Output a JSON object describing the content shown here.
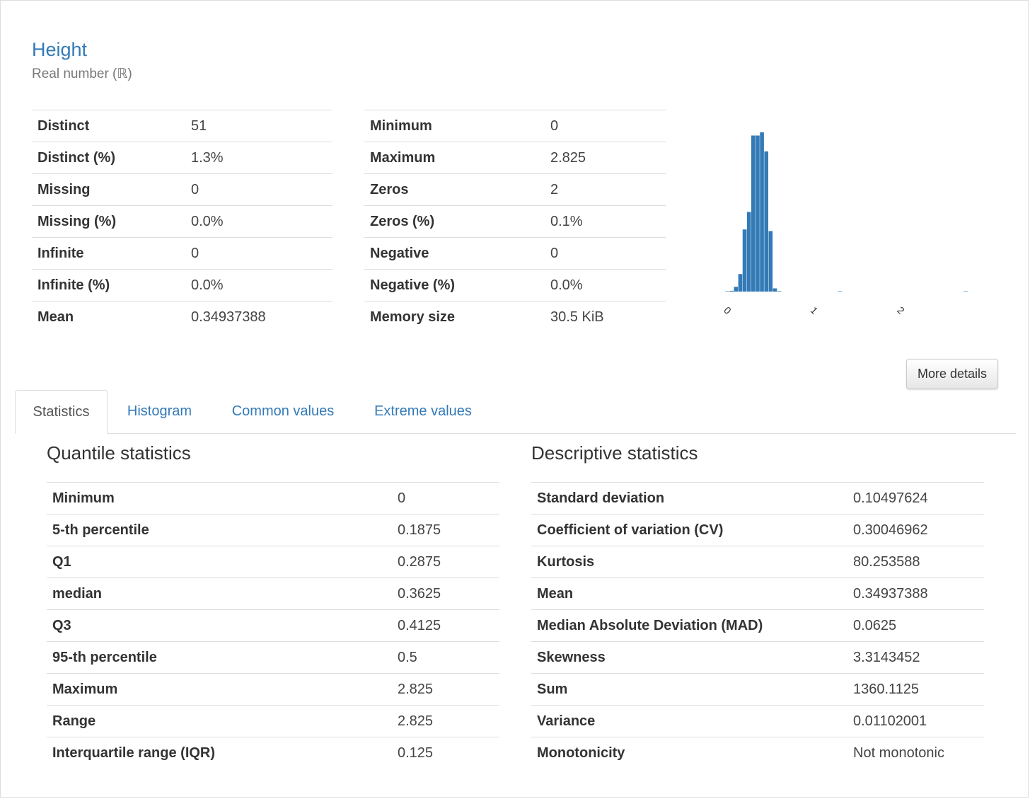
{
  "variable": {
    "name": "Height",
    "type": "Real number (ℝ)"
  },
  "overview_left": [
    {
      "label": "Distinct",
      "value": "51"
    },
    {
      "label": "Distinct (%)",
      "value": "1.3%"
    },
    {
      "label": "Missing",
      "value": "0"
    },
    {
      "label": "Missing (%)",
      "value": "0.0%"
    },
    {
      "label": "Infinite",
      "value": "0"
    },
    {
      "label": "Infinite (%)",
      "value": "0.0%"
    },
    {
      "label": "Mean",
      "value": "0.34937388"
    }
  ],
  "overview_right": [
    {
      "label": "Minimum",
      "value": "0"
    },
    {
      "label": "Maximum",
      "value": "2.825"
    },
    {
      "label": "Zeros",
      "value": "2"
    },
    {
      "label": "Zeros (%)",
      "value": "0.1%"
    },
    {
      "label": "Negative",
      "value": "0"
    },
    {
      "label": "Negative (%)",
      "value": "0.0%"
    },
    {
      "label": "Memory size",
      "value": "30.5 KiB"
    }
  ],
  "more_details_label": "More details",
  "tabs": [
    {
      "label": "Statistics",
      "active": true
    },
    {
      "label": "Histogram",
      "active": false
    },
    {
      "label": "Common values",
      "active": false
    },
    {
      "label": "Extreme values",
      "active": false
    }
  ],
  "quantile_statistics": {
    "title": "Quantile statistics",
    "rows": [
      {
        "label": "Minimum",
        "value": "0"
      },
      {
        "label": "5-th percentile",
        "value": "0.1875"
      },
      {
        "label": "Q1",
        "value": "0.2875"
      },
      {
        "label": "median",
        "value": "0.3625"
      },
      {
        "label": "Q3",
        "value": "0.4125"
      },
      {
        "label": "95-th percentile",
        "value": "0.5"
      },
      {
        "label": "Maximum",
        "value": "2.825"
      },
      {
        "label": "Range",
        "value": "2.825"
      },
      {
        "label": "Interquartile range (IQR)",
        "value": "0.125"
      }
    ]
  },
  "descriptive_statistics": {
    "title": "Descriptive statistics",
    "rows": [
      {
        "label": "Standard deviation",
        "value": "0.10497624"
      },
      {
        "label": "Coefficient of variation (CV)",
        "value": "0.30046962"
      },
      {
        "label": "Kurtosis",
        "value": "80.253588"
      },
      {
        "label": "Mean",
        "value": "0.34937388"
      },
      {
        "label": "Median Absolute Deviation (MAD)",
        "value": "0.0625"
      },
      {
        "label": "Skewness",
        "value": "3.3143452"
      },
      {
        "label": "Sum",
        "value": "1360.1125"
      },
      {
        "label": "Variance",
        "value": "0.01102001"
      },
      {
        "label": "Monotonicity",
        "value": "Not monotonic"
      }
    ]
  },
  "chart_data": {
    "type": "bar",
    "title": "",
    "xlabel": "",
    "ylabel": "",
    "bar_color": "#337ab7",
    "x_ticks": [
      "0",
      "1",
      "2"
    ],
    "xlim": [
      0,
      2.825
    ],
    "bin_width": 0.05,
    "bin_starts": [
      0,
      0.05,
      0.1,
      0.15,
      0.2,
      0.25,
      0.3,
      0.35,
      0.4,
      0.45,
      0.5,
      0.55,
      0.6,
      0.65,
      0.7,
      0.75,
      0.8,
      0.85,
      0.9,
      0.95,
      1.0,
      1.05,
      1.1,
      1.15,
      1.2,
      1.25,
      1.3,
      1.35,
      1.4,
      1.45,
      1.5,
      1.55,
      1.6,
      1.65,
      1.7,
      1.75,
      1.8,
      1.85,
      1.9,
      1.95,
      2.0,
      2.05,
      2.1,
      2.15,
      2.2,
      2.25,
      2.3,
      2.35,
      2.4,
      2.45,
      2.5,
      2.55,
      2.6,
      2.65,
      2.7,
      2.75
    ],
    "values": [
      0.2,
      0.5,
      3,
      11,
      39,
      50,
      98,
      98,
      100,
      88,
      38,
      2,
      0.3,
      0,
      0,
      0,
      0,
      0,
      0,
      0,
      0,
      0,
      0,
      0,
      0,
      0,
      0.1,
      0,
      0,
      0,
      0,
      0,
      0,
      0,
      0,
      0,
      0,
      0,
      0,
      0,
      0,
      0,
      0,
      0,
      0,
      0,
      0,
      0,
      0,
      0,
      0,
      0,
      0,
      0,
      0,
      0.1
    ],
    "ylim": [
      0,
      100
    ]
  }
}
